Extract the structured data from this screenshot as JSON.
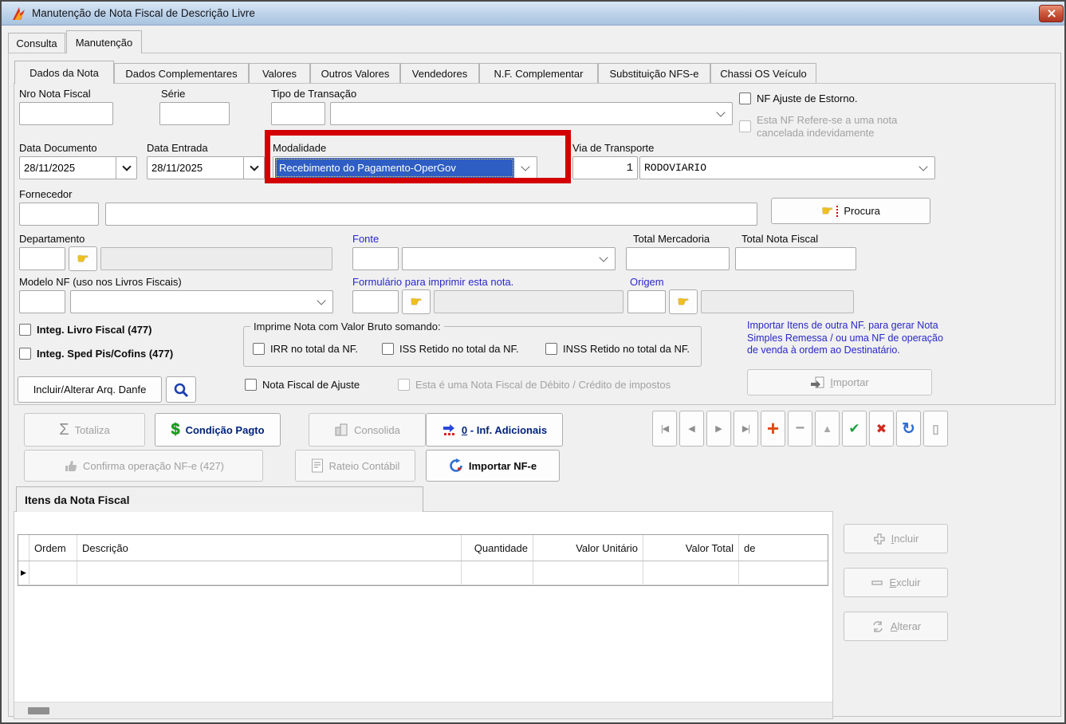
{
  "window": {
    "title": "Manutenção de Nota Fiscal de Descrição Livre"
  },
  "main_tabs": [
    {
      "label": "Consulta"
    },
    {
      "label": "Manutenção"
    }
  ],
  "detail_tabs": [
    {
      "label": "Dados da Nota"
    },
    {
      "label": "Dados Complementares"
    },
    {
      "label": "Valores"
    },
    {
      "label": "Outros Valores"
    },
    {
      "label": "Vendedores"
    },
    {
      "label": "N.F. Complementar"
    },
    {
      "label": "Substituição NFS-e"
    },
    {
      "label": "Chassi OS Veículo"
    }
  ],
  "form": {
    "nro_nota_fiscal_label": "Nro Nota Fiscal",
    "serie_label": "Série",
    "tipo_transacao_label": "Tipo de Transação",
    "nf_ajuste_estorno_label": "NF Ajuste de Estorno.",
    "nf_cancelada_label": "Esta NF Refere-se a uma nota cancelada indevidamente",
    "data_documento_label": "Data Documento",
    "data_documento_value": "28/11/2025",
    "data_entrada_label": "Data Entrada",
    "data_entrada_value": "28/11/2025",
    "modalidade_label": "Modalidade",
    "modalidade_value": "Recebimento do Pagamento-OperGov",
    "via_transporte_label": "Via de Transporte",
    "via_transporte_code": "1",
    "via_transporte_value": "RODOVIARIO",
    "fornecedor_label": "Fornecedor",
    "procura_label": "Procura",
    "departamento_label": "Departamento",
    "fonte_label": "Fonte",
    "total_mercadoria_label": "Total Mercadoria",
    "total_nota_fiscal_label": "Total Nota Fiscal",
    "modelo_nf_label": "Modelo NF (uso nos Livros Fiscais)",
    "formulario_label": "Formulário para imprimir esta nota.",
    "origem_label": "Origem",
    "integ_livro_label": "Integ. Livro Fiscal (477)",
    "integ_sped_label": "Integ. Sped Pis/Cofins (477)",
    "danfe_button_label": "Incluir/Alterar Arq. Danfe",
    "imprime_group_title": "Imprime Nota com Valor Bruto somando:",
    "irr_label": "IRR no total da NF.",
    "iss_label": "ISS Retido no total da NF.",
    "inss_label": "INSS Retido no total da NF.",
    "nf_ajuste_label": "Nota Fiscal de Ajuste",
    "nf_debito_label": "Esta é uma Nota Fiscal de Débito / Crédito de impostos",
    "importar_info": "Importar Itens de outra NF. para gerar Nota Simples Remessa / ou uma NF de operação de venda à ordem ao Destinatário.",
    "importar_accel": "I",
    "importar_rest": "mportar"
  },
  "toolbar": {
    "totaliza": "Totaliza",
    "condicao_pagto": "Condição Pagto",
    "consolida": "Consolida",
    "inf_adicionais_accel": "0",
    "inf_adicionais_rest": " - Inf. Adicionais",
    "confirma_nfe": "Confirma operação NF-e (427)",
    "rateio": "Rateio Contábil",
    "importar_nfe": "Importar NF-e"
  },
  "items": {
    "tab_label": "Itens da Nota Fiscal",
    "columns": [
      "Ordem",
      "Descrição",
      "Quantidade",
      "Valor Unitário",
      "Valor Total",
      "de"
    ],
    "incluir_accel": "I",
    "incluir_rest": "ncluir",
    "excluir_accel": "E",
    "excluir_rest": "xcluir",
    "alterar_accel": "A",
    "alterar_rest": "lterar"
  },
  "glyphs": {
    "hand": "☛",
    "sigma": "Σ",
    "dollar": "$",
    "nav_first": "|◀",
    "nav_prior": "◀",
    "nav_next": "▶",
    "nav_last": "▶|",
    "nav_insert": "+",
    "nav_delete": "−",
    "nav_edit": "▲",
    "nav_post": "✔",
    "nav_cancel": "✖",
    "nav_refresh": "↻",
    "nav_exit": "▯",
    "row_indicator": "▶"
  },
  "colors": {
    "annotation_box": "#d40000",
    "selection_blue": "#2e5ec4",
    "blue_label": "#2a28c8",
    "close_red": "#b03421",
    "titlebar_blue": "#b9d0e8"
  }
}
